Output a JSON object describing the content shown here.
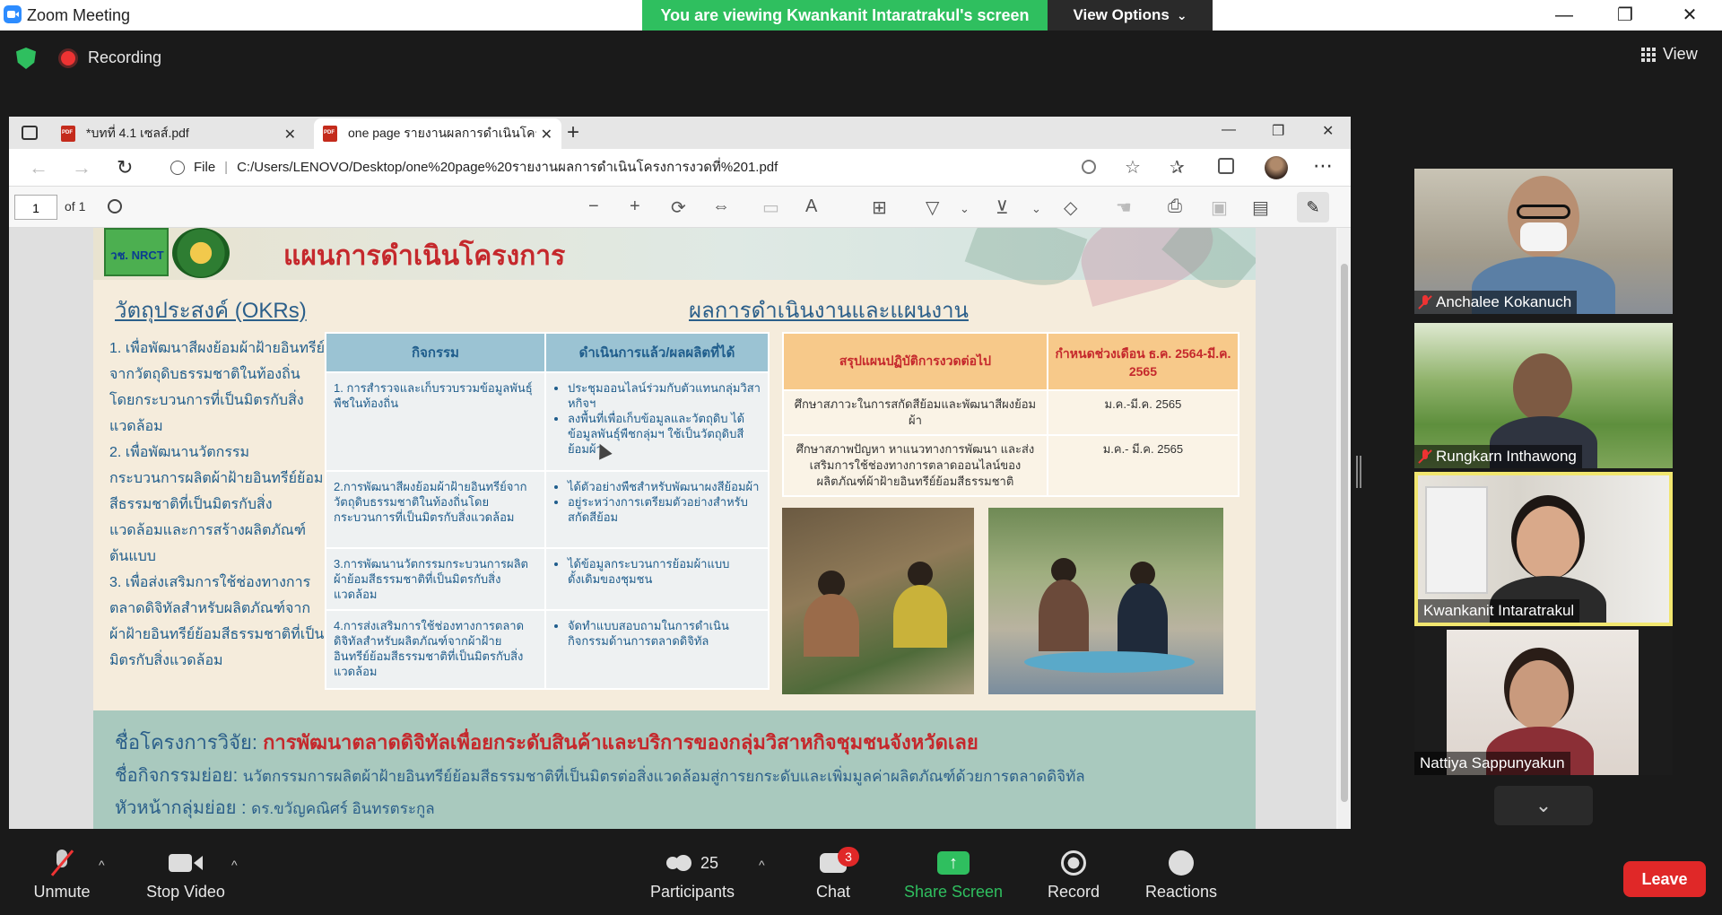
{
  "zoom": {
    "app_title": "Zoom Meeting",
    "viewing_banner": "You are viewing Kwankanit Intaratrakul's screen",
    "view_options": "View Options",
    "view_options_caret": "⌄",
    "recording": "Recording",
    "view_label": "View",
    "window_controls": {
      "minimize": "—",
      "restore": "❐",
      "close": "✕"
    },
    "colors": {
      "banner": "#2fbf5f",
      "leave": "#e02828",
      "speaker_border": "#f1e66f",
      "accent": "#2d8cff"
    }
  },
  "browser": {
    "tabs": [
      {
        "label": "*บทที่ 4.1 เซลส์.pdf",
        "close": "✕"
      },
      {
        "label": "one page รายงานผลการดำเนินโครงฯ",
        "close": "✕"
      }
    ],
    "new_tab": "+",
    "window_controls": {
      "minimize": "—",
      "restore": "❐",
      "close": "✕"
    },
    "nav": {
      "back": "←",
      "forward": "→",
      "refresh": "↻",
      "more": "⋯"
    },
    "address": {
      "scheme_label": "File",
      "separator": "|",
      "url": "C:/Users/LENOVO/Desktop/one%20page%20รายงานผลการดำเนินโครงการงวดที่%201.pdf"
    },
    "pdf_toolbar": {
      "page": "1",
      "of_pages": "of 1"
    }
  },
  "slide": {
    "title": "แผนการดำเนินโครงการ",
    "logo_text": "วช. NRCT",
    "okr_heading": "วัตถุประสงค์ (OKRs)",
    "results_heading": "ผลการดำเนินงานและแผนงาน",
    "okrs": [
      "1. เพื่อพัฒนาสีผงย้อมผ้าฝ้ายอินทรีย์จากวัตถุดิบธรรมชาติในท้องถิ่นโดยกระบวนการที่เป็นมิตรกับสิ่งแวดล้อม",
      "2. เพื่อพัฒนานวัตกรรมกระบวนการผลิตผ้าฝ้ายอินทรีย์ย้อมสีธรรมชาติที่เป็นมิตรกับสิ่งแวดล้อมและการสร้างผลิตภัณฑ์ต้นแบบ",
      "3. เพื่อส่งเสริมการใช้ช่องทางการตลาดดิจิทัลสำหรับผลิตภัณฑ์จากผ้าฝ้ายอินทรีย์ย้อมสีธรรมชาติที่เป็นมิตรกับสิ่งแวดล้อม"
    ],
    "activities_table": {
      "headers": [
        "กิจกรรม",
        "ดำเนินการแล้ว/ผลผลิตที่ได้"
      ],
      "rows": [
        {
          "activity": "1. การสำรวจและเก็บรวบรวมข้อมูลพันธุ์พืชในท้องถิ่น",
          "results": [
            "ประชุมออนไลน์ร่วมกับตัวแทนกลุ่มวิสาหกิจฯ",
            "ลงพื้นที่เพื่อเก็บข้อมูลและวัตถุดิบ ได้ข้อมูลพันธุ์พืชกลุ่มฯ ใช้เป็นวัตถุดิบสีย้อมผ้า"
          ]
        },
        {
          "activity": "2.การพัฒนาสีผงย้อมผ้าฝ้ายอินทรีย์จากวัตถุดิบธรรมชาติในท้องถิ่นโดยกระบวนการที่เป็นมิตรกับสิ่งแวดล้อม",
          "results": [
            "ได้ตัวอย่างพืชสำหรับพัฒนาผงสีย้อมผ้า",
            "อยู่ระหว่างการเตรียมตัวอย่างสำหรับสกัดสีย้อม"
          ]
        },
        {
          "activity": "3.การพัฒนานวัตกรรมกระบวนการผลิตผ้าย้อมสีธรรมชาติที่เป็นมิตรกับสิ่งแวดล้อม",
          "results": [
            "ได้ข้อมูลกระบวนการย้อมผ้าแบบดั้งเดิมของชุมชน"
          ]
        },
        {
          "activity": "4.การส่งเสริมการใช้ช่องทางการตลาดดิจิทัลสำหรับผลิตภัณฑ์จากผ้าฝ้ายอินทรีย์ย้อมสีธรรมชาติที่เป็นมิตรกับสิ่งแวดล้อม",
          "results": [
            "จัดทำแบบสอบถามในการดำเนินกิจกรรมด้านการตลาดดิจิทัล"
          ]
        }
      ]
    },
    "plan_table": {
      "headers": [
        "สรุปแผนปฏิบัติการงวดต่อไป",
        "กำหนดช่วงเดือน ธ.ค. 2564-มี.ค. 2565"
      ],
      "rows": [
        {
          "plan": "ศึกษาสภาวะในการสกัดสีย้อมและพัฒนาสีผงย้อมผ้า",
          "period": "ม.ค.-มี.ค. 2565"
        },
        {
          "plan": "ศึกษาสภาพปัญหา หาแนวทางการพัฒนา และส่งเสริมการใช้ช่องทางการตลาดออนไลน์ของผลิตภัณฑ์ผ้าฝ้ายอินทรีย์ย้อมสีธรรมชาติ",
          "period": "ม.ค.- มี.ค. 2565"
        }
      ]
    },
    "footer": {
      "project_label": "ชื่อโครงการวิจัย: ",
      "project_value": "การพัฒนาตลาดดิจิทัลเพื่อยกระดับสินค้าและบริการของกลุ่มวิสาหกิจชุมชนจังหวัดเลย",
      "sub_label": "ชื่อกิจกรรมย่อย: ",
      "sub_value": "นวัตกรรมการผลิตผ้าฝ้ายอินทรีย์ย้อมสีธรรมชาติที่เป็นมิตรต่อสิ่งแวดล้อมสู่การยกระดับและเพิ่มมูลค่าผลิตภัณฑ์ด้วยการตลาดดิจิทัล",
      "lead_label": "หัวหน้ากลุ่มย่อย : ",
      "lead_value": "ดร.ขวัญคณิศร์ อินทรตระกูล"
    }
  },
  "participants": [
    {
      "name": "Anchalee Kokanuch",
      "muted": true,
      "speaking": false
    },
    {
      "name": "Rungkarn Inthawong",
      "muted": true,
      "speaking": false
    },
    {
      "name": "Kwankanit Intaratrakul",
      "muted": false,
      "speaking": true
    },
    {
      "name": "Nattiya Sappunyakun",
      "muted": false,
      "speaking": false
    }
  ],
  "gallery_more": "⌄",
  "toolbar": {
    "unmute": "Unmute",
    "stop_video": "Stop Video",
    "participants": "Participants",
    "participants_count": "25",
    "chat": "Chat",
    "chat_badge": "3",
    "share_screen": "Share Screen",
    "record": "Record",
    "reactions": "Reactions",
    "leave": "Leave",
    "caret": "^"
  }
}
